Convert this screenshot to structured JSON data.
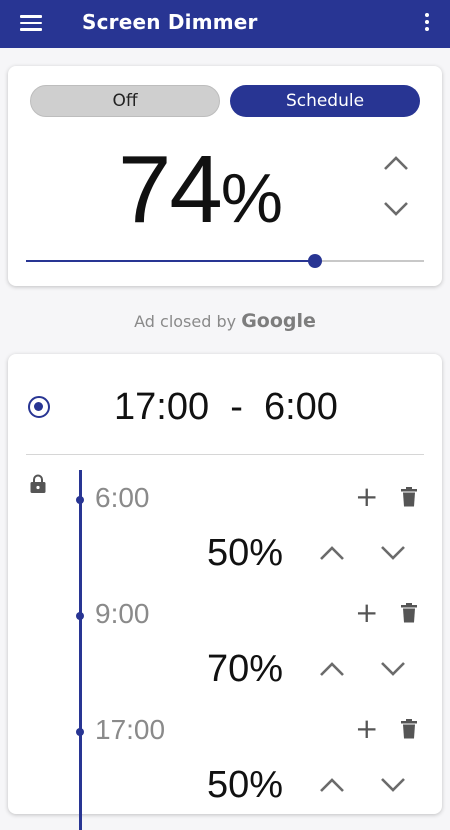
{
  "app": {
    "title": "Screen Dimmer",
    "accent_color": "#283593"
  },
  "dimmer": {
    "mode_off_label": "Off",
    "mode_schedule_label": "Schedule",
    "active_mode": "Schedule",
    "level_value": "74",
    "level_unit": "%",
    "slider_fraction": 0.725
  },
  "ad": {
    "prefix": "Ad closed by ",
    "brand": "Google"
  },
  "schedule": {
    "range_text": "17:00  -  6:00",
    "entries": [
      {
        "time": "6:00",
        "level": "50%"
      },
      {
        "time": "9:00",
        "level": "70%"
      },
      {
        "time": "17:00",
        "level": "50%"
      }
    ]
  },
  "icons": {
    "menu": "menu-icon",
    "more": "more-vert-icon",
    "chevron_up": "chevron-up-icon",
    "chevron_down": "chevron-down-icon",
    "radio": "radio-selected-icon",
    "lock": "lock-icon",
    "add": "add-icon",
    "delete": "trash-icon"
  }
}
